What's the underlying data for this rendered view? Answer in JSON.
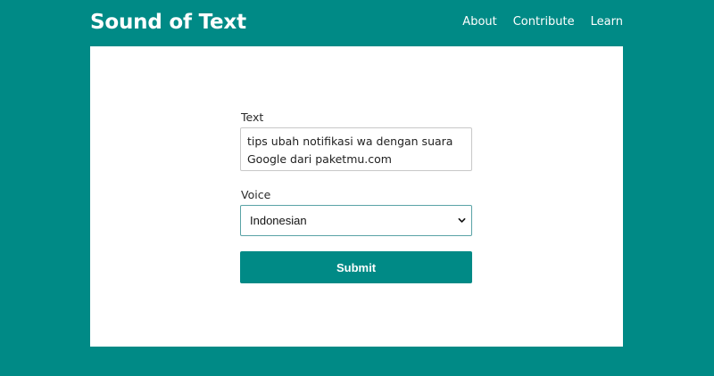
{
  "header": {
    "brand": "Sound of Text",
    "nav": [
      "About",
      "Contribute",
      "Learn"
    ]
  },
  "form": {
    "text_label": "Text",
    "text_value": "tips ubah notifikasi wa dengan suara Google dari paketmu.com",
    "voice_label": "Voice",
    "voice_selected": "Indonesian",
    "submit_label": "Submit"
  },
  "colors": {
    "accent": "#008a86",
    "card": "#ffffff",
    "select_border": "#5aa3a6"
  }
}
